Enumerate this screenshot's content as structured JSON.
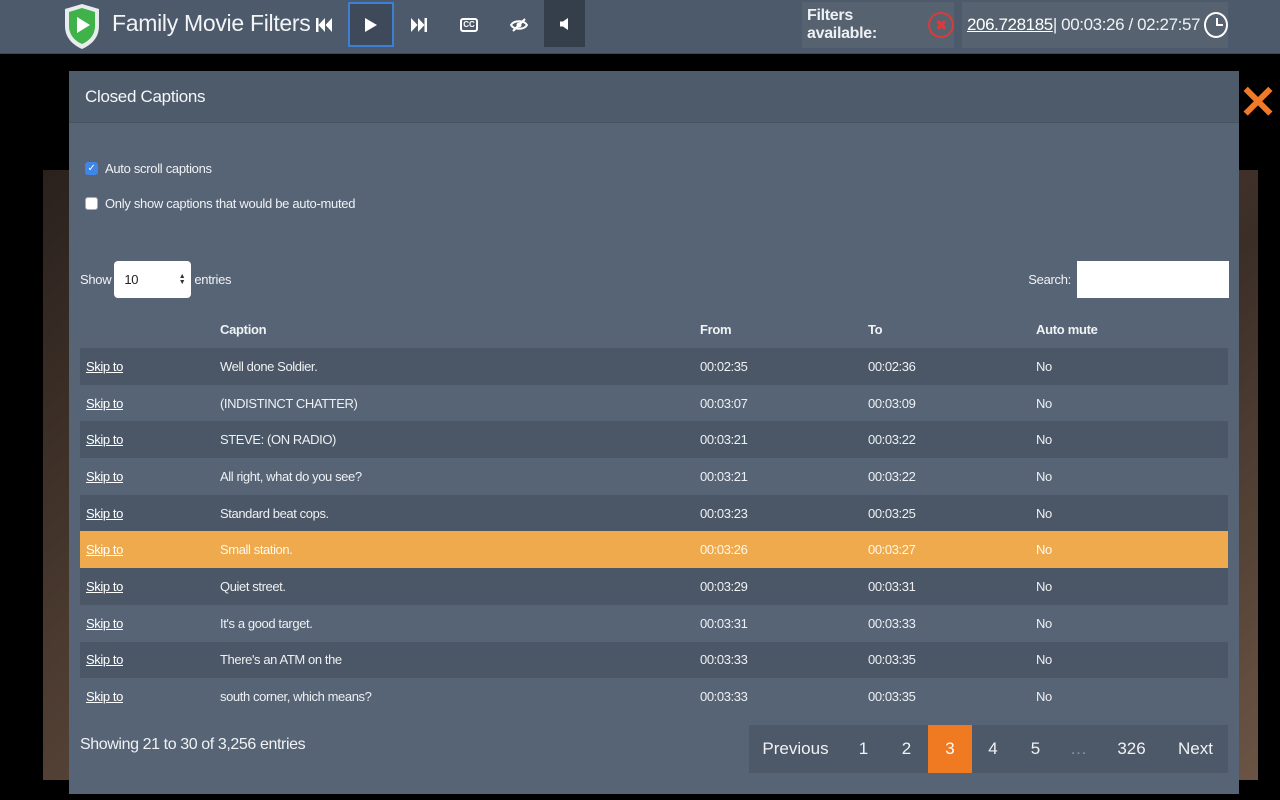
{
  "toolbar": {
    "app_title": "Family Movie Filters",
    "buttons": [
      "prev-track",
      "play",
      "next-track",
      "closed-captions",
      "hide-filtered",
      "mute"
    ],
    "cc_label": "CC",
    "filters_label": "Filters available:",
    "position_seconds": "206.728185",
    "time_display": " | 00:03:26 / 02:27:57"
  },
  "dialog": {
    "title": "Closed Captions",
    "options": {
      "auto_scroll": {
        "label": "Auto scroll captions",
        "checked": true
      },
      "only_muted": {
        "label": "Only show captions that would be auto-muted",
        "checked": false
      }
    },
    "show_prefix": "Show",
    "show_value": "10",
    "show_suffix": "entries",
    "search_label": "Search:",
    "search_value": "",
    "columns": [
      "",
      "Caption",
      "From",
      "To",
      "Auto mute"
    ],
    "rows": [
      {
        "skip": "Skip to",
        "caption": "Well done Soldier.",
        "from": "00:02:35",
        "to": "00:02:36",
        "mute": "No"
      },
      {
        "skip": "Skip to",
        "caption": "(INDISTINCT CHATTER)",
        "from": "00:03:07",
        "to": "00:03:09",
        "mute": "No"
      },
      {
        "skip": "Skip to",
        "caption": "STEVE: (ON RADIO)",
        "from": "00:03:21",
        "to": "00:03:22",
        "mute": "No"
      },
      {
        "skip": "Skip to",
        "caption": "All right, what do you see?",
        "from": "00:03:21",
        "to": "00:03:22",
        "mute": "No"
      },
      {
        "skip": "Skip to",
        "caption": "Standard beat cops.",
        "from": "00:03:23",
        "to": "00:03:25",
        "mute": "No"
      },
      {
        "skip": "Skip to",
        "caption": "Small station.",
        "from": "00:03:26",
        "to": "00:03:27",
        "mute": "No"
      },
      {
        "skip": "Skip to",
        "caption": "Quiet street.",
        "from": "00:03:29",
        "to": "00:03:31",
        "mute": "No"
      },
      {
        "skip": "Skip to",
        "caption": "It's a good target.",
        "from": "00:03:31",
        "to": "00:03:33",
        "mute": "No"
      },
      {
        "skip": "Skip to",
        "caption": "There's an ATM on the",
        "from": "00:03:33",
        "to": "00:03:35",
        "mute": "No"
      },
      {
        "skip": "Skip to",
        "caption": "south corner, which means?",
        "from": "00:03:33",
        "to": "00:03:35",
        "mute": "No"
      }
    ],
    "highlighted_row": 5,
    "info": "Showing 21 to 30 of 3,256 entries",
    "pagination": {
      "previous": "Previous",
      "pages": [
        "1",
        "2",
        "3",
        "4",
        "5",
        "…",
        "326"
      ],
      "current": "3",
      "next": "Next"
    }
  },
  "colors": {
    "highlight": "#eeaa4c",
    "current_page": "#ef7a22",
    "close": "#f07a25",
    "filter_none": "#d93b3b",
    "logo_green": "#3fb24a"
  }
}
